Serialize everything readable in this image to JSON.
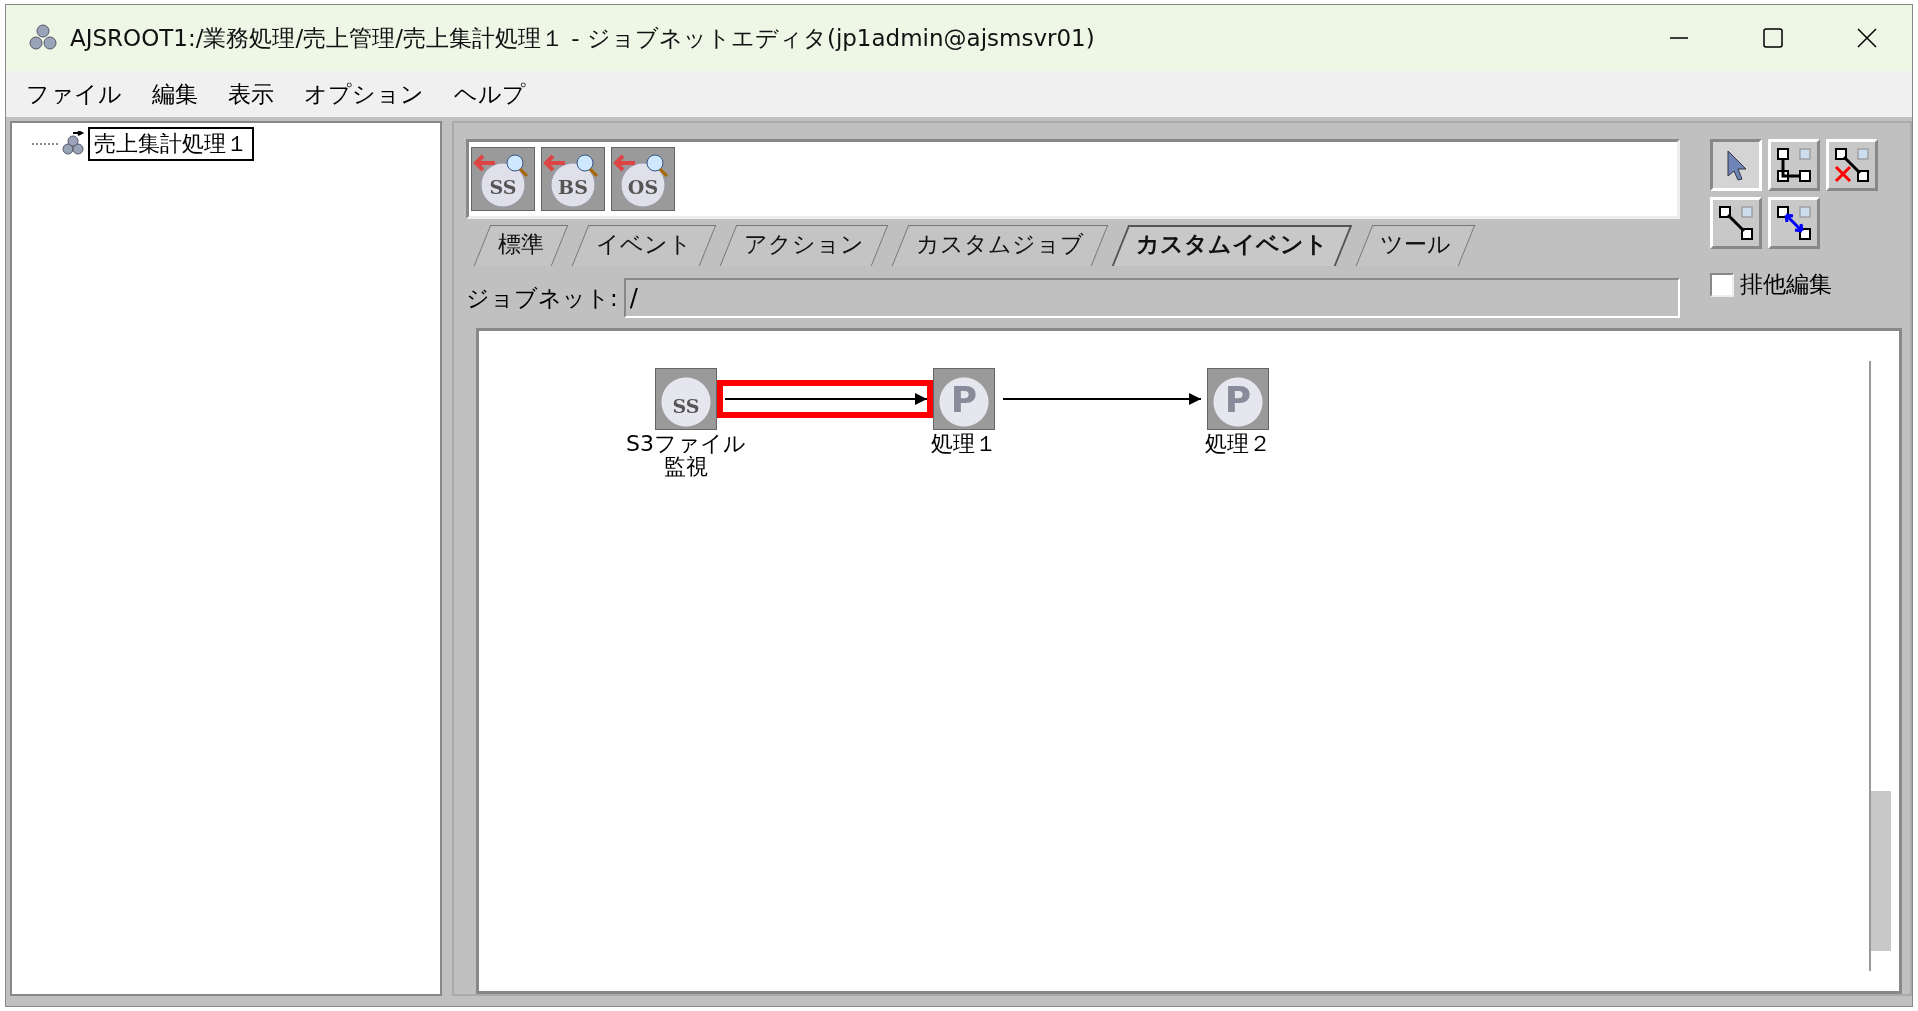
{
  "window": {
    "title": "AJSROOT1:/業務処理/売上管理/売上集計処理１ - ジョブネットエディタ(jp1admin@ajsmsvr01)"
  },
  "menu": [
    "ファイル",
    "編集",
    "表示",
    "オプション",
    "ヘルプ"
  ],
  "tree": [
    {
      "label": "売上集計処理１",
      "selected": true
    }
  ],
  "palette": [
    {
      "label": "SS"
    },
    {
      "label": "BS"
    },
    {
      "label": "OS"
    }
  ],
  "tabs": [
    {
      "label": "標準",
      "selected": false
    },
    {
      "label": "イベント",
      "selected": false
    },
    {
      "label": "アクション",
      "selected": false
    },
    {
      "label": "カスタムジョブ",
      "selected": false
    },
    {
      "label": "カスタムイベント",
      "selected": true
    },
    {
      "label": "ツール",
      "selected": false
    }
  ],
  "tools": [
    {
      "kind": "select",
      "selected": true
    },
    {
      "kind": "connect",
      "selected": false
    },
    {
      "kind": "disconnect",
      "selected": false
    },
    {
      "kind": "relation",
      "selected": false
    },
    {
      "kind": "reverse",
      "selected": false
    }
  ],
  "jobnet": {
    "label": "ジョブネット:",
    "value": "/"
  },
  "exclusive_edit": {
    "label": "排他編集",
    "checked": false
  },
  "nodes": [
    {
      "kind": "event",
      "icon_text": "SS",
      "label_lines": [
        "S3ファイル",
        "監視"
      ]
    },
    {
      "kind": "job",
      "icon_text": "P",
      "label_lines": [
        "処理１"
      ]
    },
    {
      "kind": "job",
      "icon_text": "P",
      "label_lines": [
        "処理２"
      ]
    }
  ],
  "edges": [
    {
      "highlighted": true
    },
    {
      "highlighted": false
    }
  ]
}
